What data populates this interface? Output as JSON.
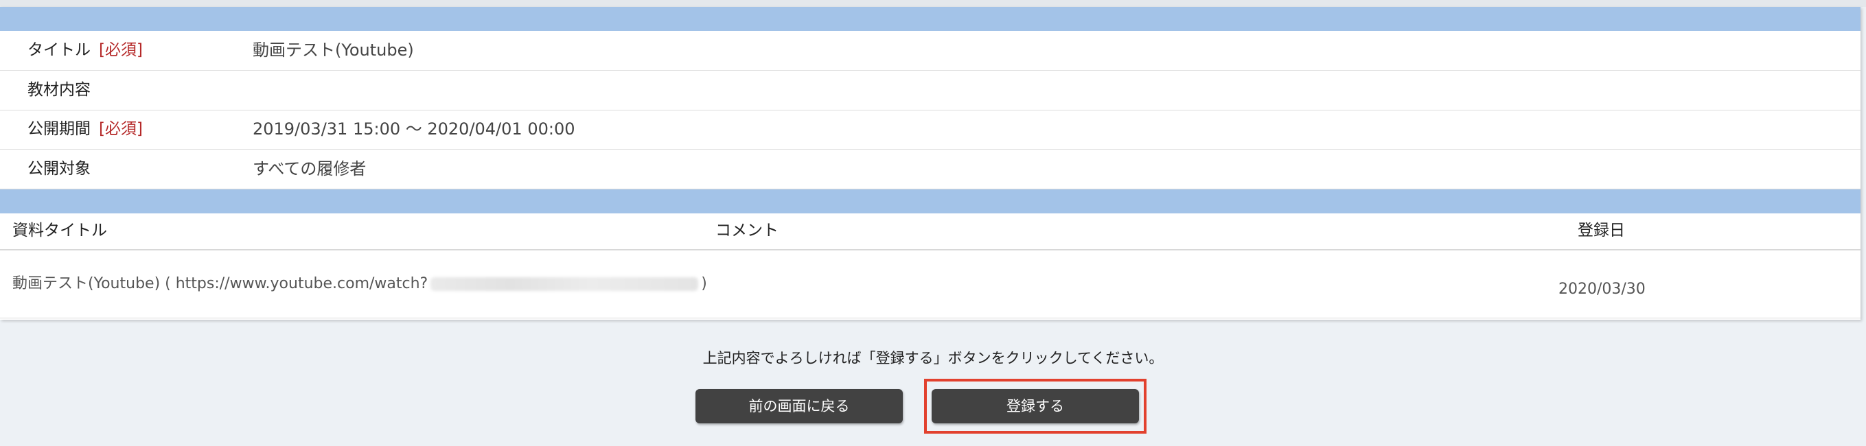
{
  "form": {
    "rows": [
      {
        "label": "タイトル",
        "required": "[必須]",
        "value": "動画テスト(Youtube)"
      },
      {
        "label": "教材内容",
        "required": "",
        "value": ""
      },
      {
        "label": "公開期間",
        "required": "[必須]",
        "value": "2019/03/31 15:00 〜 2020/04/01 00:00"
      },
      {
        "label": "公開対象",
        "required": "",
        "value": "すべての履修者"
      }
    ]
  },
  "table": {
    "headers": [
      "資料タイトル",
      "コメント",
      "登録日"
    ],
    "row": {
      "title_prefix": "動画テスト(Youtube) ( https://www.youtube.com/watch?",
      "title_suffix": ")",
      "comment": "",
      "date": "2020/03/30"
    }
  },
  "confirm": {
    "message": "上記内容でよろしければ「登録する」ボタンをクリックしてください。",
    "back_label": "前の画面に戻る",
    "submit_label": "登録する"
  },
  "colors": {
    "band": "#a3c3e8",
    "button": "#424242",
    "highlight": "#e2412e",
    "required": "#b52a2a"
  }
}
